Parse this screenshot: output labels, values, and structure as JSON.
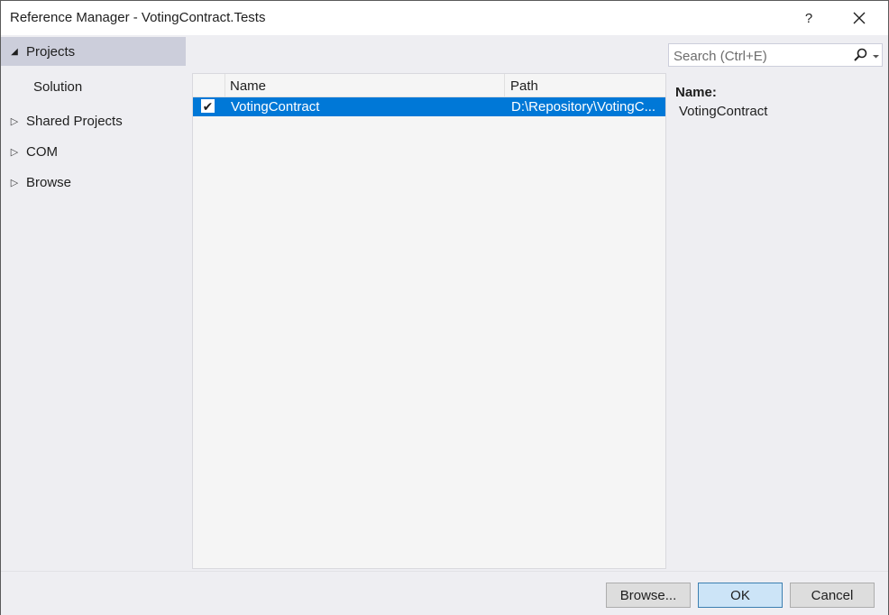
{
  "window": {
    "title": "Reference Manager - VotingContract.Tests",
    "help_label": "?",
    "close_label": "✕"
  },
  "nav": {
    "items": [
      {
        "label": "Projects",
        "arrow": "◢",
        "state": "expanded",
        "selected": true
      },
      {
        "label": "Solution",
        "arrow": "",
        "state": "child",
        "selected": false
      },
      {
        "label": "Shared Projects",
        "arrow": "▷",
        "state": "collapsed",
        "selected": false
      },
      {
        "label": "COM",
        "arrow": "▷",
        "state": "collapsed",
        "selected": false
      },
      {
        "label": "Browse",
        "arrow": "▷",
        "state": "collapsed",
        "selected": false
      }
    ]
  },
  "list": {
    "columns": {
      "name": "Name",
      "path": "Path"
    },
    "rows": [
      {
        "checked": true,
        "check_glyph": "✔",
        "name": "VotingContract",
        "path": "D:\\Repository\\VotingC..."
      }
    ]
  },
  "search": {
    "placeholder": "Search (Ctrl+E)",
    "value": ""
  },
  "details": {
    "name_label": "Name:",
    "name_value": "VotingContract"
  },
  "buttons": {
    "browse": "Browse...",
    "ok": "OK",
    "cancel": "Cancel"
  },
  "colors": {
    "selection": "#0078d7",
    "nav_selected": "#cccedb",
    "ok_button": "#cce4f7"
  }
}
